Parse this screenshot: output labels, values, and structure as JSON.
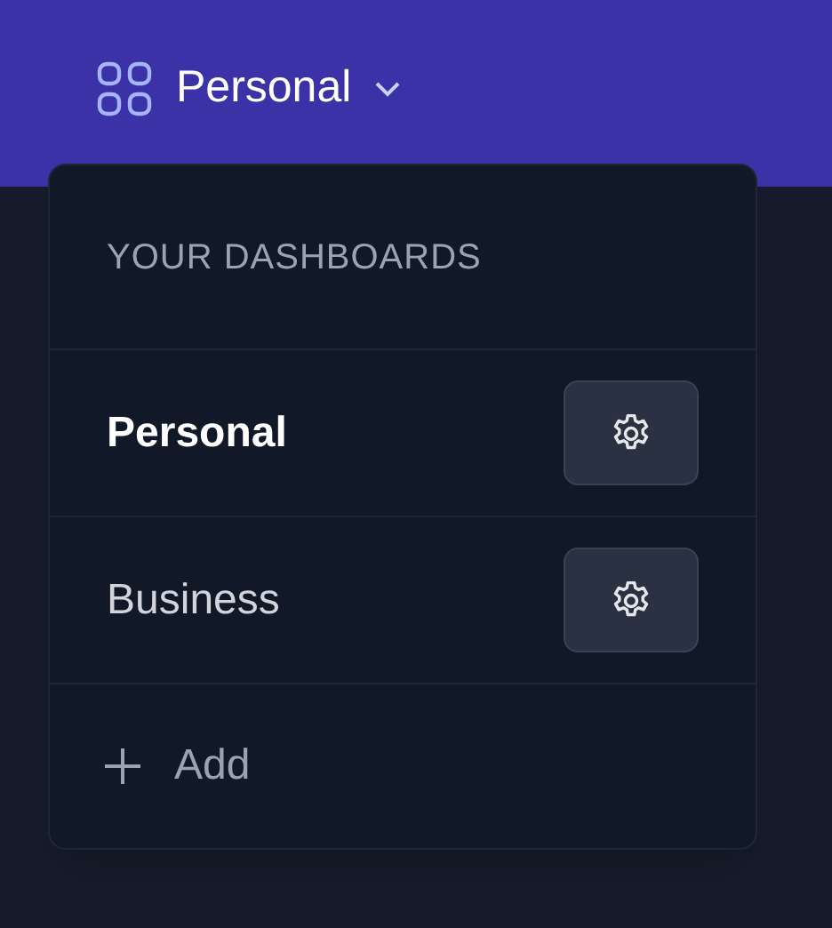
{
  "header": {
    "title": "Personal"
  },
  "dropdown": {
    "heading": "YOUR DASHBOARDS",
    "items": [
      {
        "label": "Personal",
        "selected": true
      },
      {
        "label": "Business",
        "selected": false
      }
    ],
    "add_label": "Add"
  }
}
